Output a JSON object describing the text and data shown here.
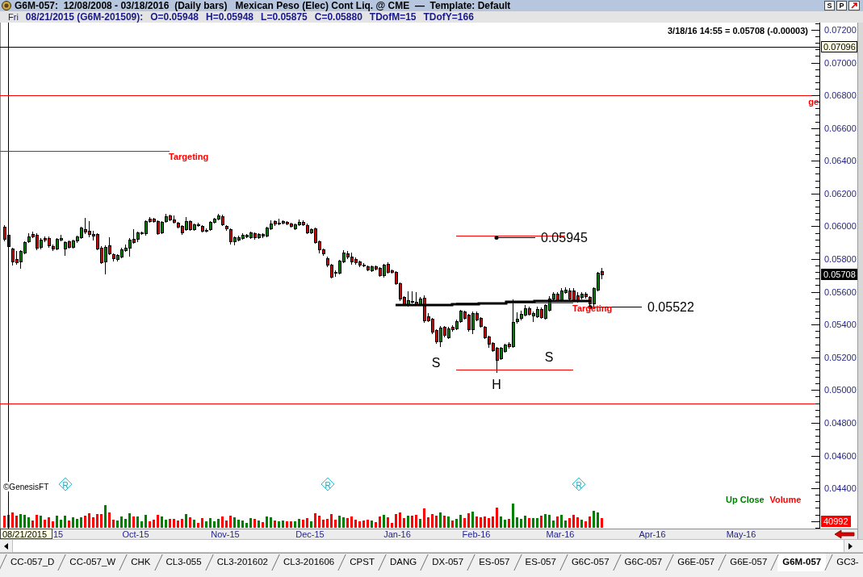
{
  "window": {
    "title": "G6M-057:  12/08/2008 - 03/18/2016  (Daily bars)   Mexican Peso (Elec) Cont Liq. @ CME  —  Template: Default",
    "buttons": [
      "S",
      "P"
    ]
  },
  "info_bar": {
    "day": "Fri",
    "fields": [
      "08/21/2015 (G6M-201509):",
      "O=0.05948",
      "H=0.05948",
      "L=0.05875",
      "C=0.05880",
      "TDofM=15",
      "TDofY=166"
    ]
  },
  "chart": {
    "quote": "3/18/16 14:55 = 0.05708 (-0.00003)",
    "price_axis": [
      "0.07200",
      "0.07000",
      "0.06800",
      "0.06600",
      "0.06400",
      "0.06200",
      "0.06000",
      "0.05800",
      "0.05600",
      "0.05400",
      "0.05200",
      "0.05000",
      "0.04800",
      "0.04600",
      "0.04400"
    ],
    "price_tags": [
      {
        "kind": "line",
        "label": "0.07096"
      },
      {
        "kind": "last",
        "label": "0.05708"
      }
    ],
    "annotations": [
      {
        "kind": "target",
        "label": "ge"
      },
      {
        "kind": "target",
        "label": "Targeting"
      },
      {
        "kind": "price",
        "label": "0.05945"
      },
      {
        "kind": "target",
        "label": "Targeting"
      },
      {
        "kind": "price",
        "label": "0.05522"
      },
      {
        "kind": "pattern",
        "label": "S"
      },
      {
        "kind": "pattern",
        "label": "H"
      },
      {
        "kind": "pattern",
        "label": "S"
      }
    ],
    "markers": [
      "R",
      "R",
      "R"
    ],
    "copyright": "©GenesisFT",
    "volume": {
      "legend": [
        {
          "label": "Up Close",
          "color": "#008000"
        },
        {
          "label": "Volume",
          "color": "#ff0000"
        }
      ],
      "last": "40992"
    },
    "cursor_date": "08/21/2015",
    "date_axis": [
      "15",
      "Oct-15",
      "Nov-15",
      "Dec-15",
      "Jan-16",
      "Feb-16",
      "Mar-16",
      "Apr-16",
      "May-16"
    ]
  },
  "tabs": [
    {
      "label": "CC-057_D",
      "selected": false
    },
    {
      "label": "CC-057_W",
      "selected": false
    },
    {
      "label": "CHK",
      "selected": false
    },
    {
      "label": "CL3-055",
      "selected": false
    },
    {
      "label": "CL3-201602",
      "selected": false
    },
    {
      "label": "CL3-201606",
      "selected": false
    },
    {
      "label": "CPST",
      "selected": false
    },
    {
      "label": "DANG",
      "selected": false
    },
    {
      "label": "DX-057",
      "selected": false
    },
    {
      "label": "ES-057",
      "selected": false
    },
    {
      "label": "ES-057",
      "selected": false
    },
    {
      "label": "G6C-057",
      "selected": false
    },
    {
      "label": "G6C-057",
      "selected": false
    },
    {
      "label": "G6E-057",
      "selected": false
    },
    {
      "label": "G6E-057",
      "selected": false
    },
    {
      "label": "G6M-057",
      "selected": true
    },
    {
      "label": "GC3-",
      "selected": false
    }
  ]
}
